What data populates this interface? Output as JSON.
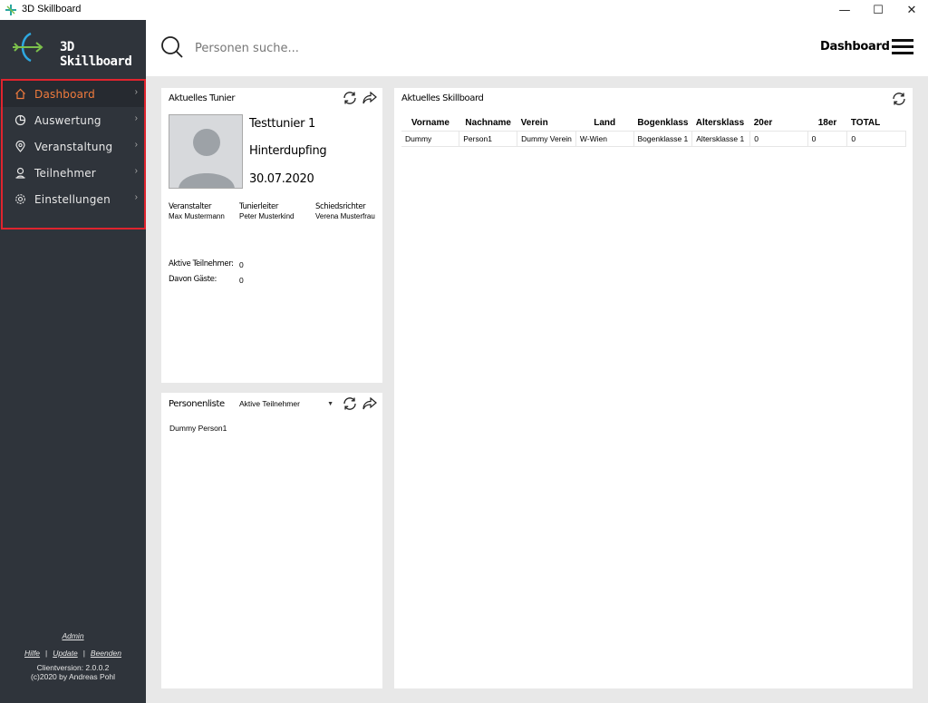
{
  "window": {
    "title": "3D Skillboard",
    "controls": {
      "minimize": "—",
      "maximize": "☐",
      "close": "✕"
    }
  },
  "sidebar": {
    "brand": "3D Skillboard",
    "active_color": "#f07b3d",
    "items": [
      {
        "label": "Dashboard",
        "icon": "home-icon",
        "active": true
      },
      {
        "label": "Auswertung",
        "icon": "pie-chart-icon",
        "active": false
      },
      {
        "label": "Veranstaltung",
        "icon": "location-pin-icon",
        "active": false
      },
      {
        "label": "Teilnehmer",
        "icon": "user-icon",
        "active": false
      },
      {
        "label": "Einstellungen",
        "icon": "gear-icon",
        "active": false
      }
    ],
    "chevron": "›",
    "footer": {
      "admin": "Admin",
      "hilfe": "Hilfe",
      "update": "Update",
      "beenden": "Beenden",
      "separator": "|",
      "version": "Clientversion: 2.0.0.2",
      "copyright": "(c)2020 by Andreas Pohl"
    }
  },
  "header": {
    "search_placeholder": "Personen suche...",
    "title": "Dashboard"
  },
  "tunier": {
    "title": "Aktuelles Tunier",
    "name": "Testtunier 1",
    "ort": "Hinterdupfing",
    "datum": "30.07.2020",
    "roles": [
      {
        "label": "Veranstalter",
        "value": "Max Mustermann"
      },
      {
        "label": "Tunierleiter",
        "value": "Peter Musterkind"
      },
      {
        "label": "Schiedsrichter",
        "value": "Verena Musterfrau"
      }
    ],
    "stats": [
      {
        "label": "Aktive Teilnehmer:",
        "value": "0"
      },
      {
        "label": "Davon Gäste:",
        "value": "0"
      }
    ]
  },
  "personenliste": {
    "title": "Personenliste",
    "filter_selected": "Aktive Teilnehmer",
    "items": [
      "Dummy Person1"
    ]
  },
  "skillboard": {
    "title": "Aktuelles Skillboard",
    "columns": [
      "Vorname",
      "Nachname",
      "Verein",
      "Land",
      "Bogenklass",
      "Altersklass",
      "20er",
      "18er",
      "TOTAL"
    ],
    "rows": [
      [
        "Dummy",
        "Person1",
        "Dummy Verein",
        "W-Wien",
        "Bogenklasse 1",
        "Altersklasse 1",
        "0",
        "0",
        "0"
      ]
    ]
  }
}
